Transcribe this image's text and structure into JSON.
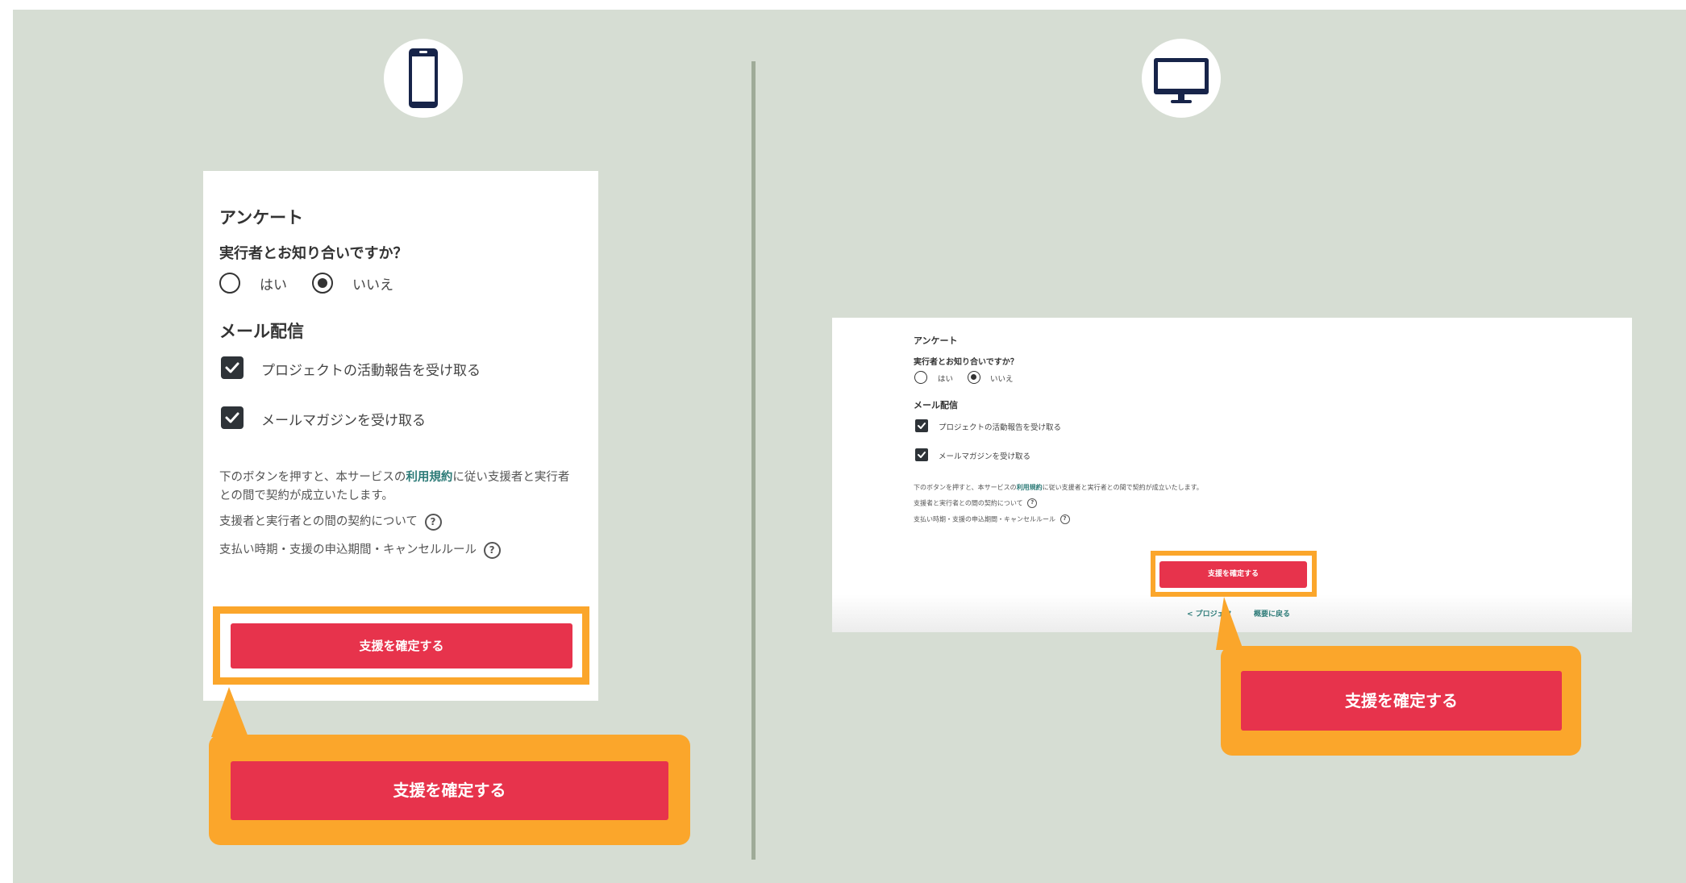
{
  "mobile": {
    "device_icon": "smartphone-icon",
    "survey_heading": "アンケート",
    "question": "実行者とお知り合いですか？",
    "options": [
      "はい",
      "いいえ"
    ],
    "selected_option": "いいえ",
    "mail_heading": "メール配信",
    "checkboxes": [
      "プロジェクトの活動報告を受け取る",
      "メールマガジンを受け取る"
    ],
    "checked": [
      true,
      true
    ],
    "terms_before": "下のボタンを押すと、本サービスの",
    "terms_link": "利用規約",
    "terms_after_line1": "に従い支援者と実行者",
    "terms_line2": "との間で契約が成立いたします。",
    "contract_link": "支援者と実行者との間の契約について",
    "payment_link": "支払い時期・支援の申込期間・キャンセルルール",
    "help_icon": "?",
    "confirm_button": "支援を確定する",
    "callout_button": "支援を確定する"
  },
  "desktop": {
    "device_icon": "monitor-icon",
    "survey_heading": "アンケート",
    "question": "実行者とお知り合いですか？",
    "options": [
      "はい",
      "いいえ"
    ],
    "selected_option": "いいえ",
    "mail_heading": "メール配信",
    "checkboxes": [
      "プロジェクトの活動報告を受け取る",
      "メールマガジンを受け取る"
    ],
    "checked": [
      true,
      true
    ],
    "terms_before": "下のボタンを押すと、本サービスの",
    "terms_link": "利用規約",
    "terms_after": "に従い支援者と実行者との間で契約が成立いたします。",
    "contract_link": "支援者と実行者との間の契約について",
    "payment_link": "支払い時期・支援の申込期間・キャンセルルール",
    "help_icon": "?",
    "confirm_button": "支援を確定する",
    "back_link_left": "< プロジェク",
    "back_link_right": "概要に戻る",
    "callout_button": "支援を確定する"
  },
  "colors": {
    "background": "#d6ddd3",
    "accent_button": "#e7334c",
    "highlight": "#fba62b",
    "link": "#2d7b78",
    "divider": "#9fab98"
  }
}
